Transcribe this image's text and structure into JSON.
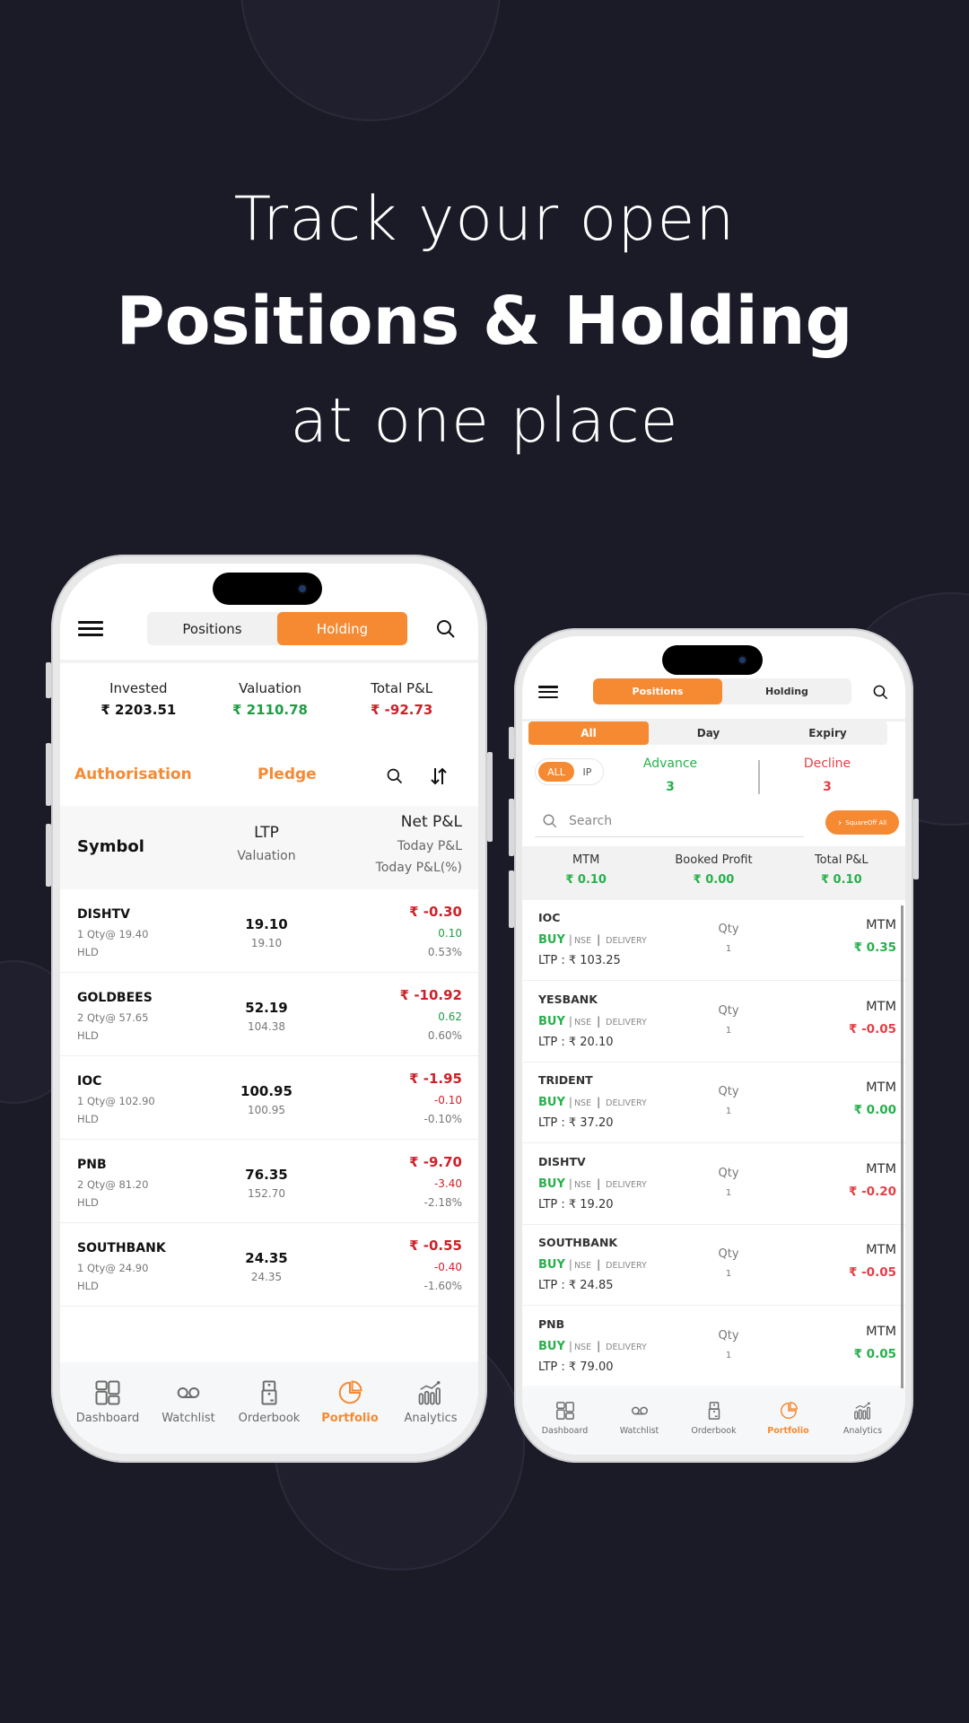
{
  "headline": {
    "line1": "Track your open",
    "line2": "Positions & Holding",
    "line3": "at one place"
  },
  "colors": {
    "background": "#1b1b28",
    "accent": "#f58a33",
    "positive": "#1f9d45",
    "negative": "#cc2129"
  },
  "left_phone": {
    "tabs": [
      {
        "label": "Positions",
        "active": false
      },
      {
        "label": "Holding",
        "active": true
      }
    ],
    "icons": {
      "menu": "hamburger-icon",
      "search": "search-icon",
      "sort": "sort-arrows-icon"
    },
    "summary": {
      "invested_label": "Invested",
      "invested_value": "₹ 2203.51",
      "valuation_label": "Valuation",
      "valuation_value": "₹ 2110.78",
      "total_pl_label": "Total P&L",
      "total_pl_value": "₹ -92.73"
    },
    "actions": {
      "authorisation": "Authorisation",
      "pledge": "Pledge"
    },
    "table_header": {
      "symbol": "Symbol",
      "ltp": "LTP",
      "valuation": "Valuation",
      "net_pl": "Net P&L",
      "today_pl": "Today P&L",
      "today_pl_pct": "Today P&L(%)"
    },
    "holdings": [
      {
        "symbol": "DISHTV",
        "qty": "1 Qty@ 19.40",
        "tag": "HLD",
        "ltp": "19.10",
        "valuation": "19.10",
        "net_pl": "₹ -0.30",
        "today_pl": "0.10",
        "today_pct": "0.53%",
        "today_sign": "pos"
      },
      {
        "symbol": "GOLDBEES",
        "qty": "2 Qty@ 57.65",
        "tag": "HLD",
        "ltp": "52.19",
        "valuation": "104.38",
        "net_pl": "₹ -10.92",
        "today_pl": "0.62",
        "today_pct": "0.60%",
        "today_sign": "pos"
      },
      {
        "symbol": "IOC",
        "qty": "1 Qty@ 102.90",
        "tag": "HLD",
        "ltp": "100.95",
        "valuation": "100.95",
        "net_pl": "₹ -1.95",
        "today_pl": "-0.10",
        "today_pct": "-0.10%",
        "today_sign": "neg"
      },
      {
        "symbol": "PNB",
        "qty": "2 Qty@ 81.20",
        "tag": "HLD",
        "ltp": "76.35",
        "valuation": "152.70",
        "net_pl": "₹ -9.70",
        "today_pl": "-3.40",
        "today_pct": "-2.18%",
        "today_sign": "neg"
      },
      {
        "symbol": "SOUTHBANK",
        "qty": "1 Qty@ 24.90",
        "tag": "HLD",
        "ltp": "24.35",
        "valuation": "24.35",
        "net_pl": "₹ -0.55",
        "today_pl": "-0.40",
        "today_pct": "-1.60%",
        "today_sign": "neg"
      }
    ],
    "nav": [
      {
        "label": "Dashboard",
        "icon": "dashboard-icon",
        "active": false
      },
      {
        "label": "Watchlist",
        "icon": "watchlist-icon",
        "active": false
      },
      {
        "label": "Orderbook",
        "icon": "orderbook-icon",
        "active": false
      },
      {
        "label": "Portfolio",
        "icon": "portfolio-icon",
        "active": true
      },
      {
        "label": "Analytics",
        "icon": "analytics-icon",
        "active": false
      }
    ]
  },
  "right_phone": {
    "tabs": [
      {
        "label": "Positions",
        "active": true
      },
      {
        "label": "Holding",
        "active": false
      }
    ],
    "filters": [
      {
        "label": "All",
        "active": true
      },
      {
        "label": "Day",
        "active": false
      },
      {
        "label": "Expiry",
        "active": false
      }
    ],
    "toggle": [
      {
        "label": "ALL",
        "active": true
      },
      {
        "label": "IP",
        "active": false
      }
    ],
    "advance_label": "Advance",
    "advance_value": "3",
    "decline_label": "Decline",
    "decline_value": "3",
    "search_placeholder": "Search",
    "squareoff_label": "SquareOff All",
    "summary": {
      "mtm_label": "MTM",
      "mtm_value": "₹ 0.10",
      "booked_label": "Booked Profit",
      "booked_value": "₹ 0.00",
      "total_label": "Total P&L",
      "total_value": "₹ 0.10"
    },
    "positions": [
      {
        "symbol": "IOC",
        "side": "BUY",
        "exchange": "NSE",
        "product": "DELIVERY",
        "ltp": "LTP : ₹ 103.25",
        "qty_label": "Qty",
        "qty": "1",
        "mtm_label": "MTM",
        "mtm": "₹ 0.35",
        "sign": "pos"
      },
      {
        "symbol": "YESBANK",
        "side": "BUY",
        "exchange": "NSE",
        "product": "DELIVERY",
        "ltp": "LTP : ₹ 20.10",
        "qty_label": "Qty",
        "qty": "1",
        "mtm_label": "MTM",
        "mtm": "₹ -0.05",
        "sign": "neg"
      },
      {
        "symbol": "TRIDENT",
        "side": "BUY",
        "exchange": "NSE",
        "product": "DELIVERY",
        "ltp": "LTP : ₹ 37.20",
        "qty_label": "Qty",
        "qty": "1",
        "mtm_label": "MTM",
        "mtm": "₹ 0.00",
        "sign": "pos"
      },
      {
        "symbol": "DISHTV",
        "side": "BUY",
        "exchange": "NSE",
        "product": "DELIVERY",
        "ltp": "LTP : ₹ 19.20",
        "qty_label": "Qty",
        "qty": "1",
        "mtm_label": "MTM",
        "mtm": "₹ -0.20",
        "sign": "neg"
      },
      {
        "symbol": "SOUTHBANK",
        "side": "BUY",
        "exchange": "NSE",
        "product": "DELIVERY",
        "ltp": "LTP : ₹ 24.85",
        "qty_label": "Qty",
        "qty": "1",
        "mtm_label": "MTM",
        "mtm": "₹ -0.05",
        "sign": "neg"
      },
      {
        "symbol": "PNB",
        "side": "BUY",
        "exchange": "NSE",
        "product": "DELIVERY",
        "ltp": "LTP : ₹ 79.00",
        "qty_label": "Qty",
        "qty": "1",
        "mtm_label": "MTM",
        "mtm": "₹ 0.05",
        "sign": "pos"
      }
    ],
    "nav": [
      {
        "label": "Dashboard",
        "icon": "dashboard-icon",
        "active": false
      },
      {
        "label": "Watchlist",
        "icon": "watchlist-icon",
        "active": false
      },
      {
        "label": "Orderbook",
        "icon": "orderbook-icon",
        "active": false
      },
      {
        "label": "Portfolio",
        "icon": "portfolio-icon",
        "active": true
      },
      {
        "label": "Analytics",
        "icon": "analytics-icon",
        "active": false
      }
    ]
  }
}
